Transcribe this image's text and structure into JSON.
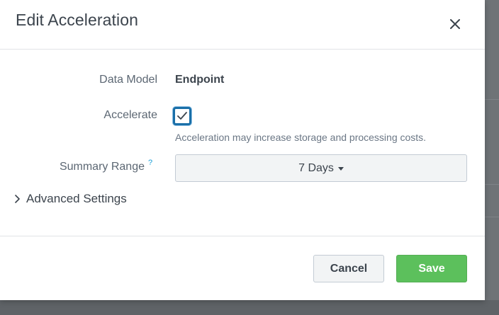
{
  "dialog": {
    "title": "Edit Acceleration"
  },
  "form": {
    "data_model": {
      "label": "Data Model",
      "value": "Endpoint"
    },
    "accelerate": {
      "label": "Accelerate",
      "checked": true,
      "help_text": "Acceleration may increase storage and processing costs."
    },
    "summary_range": {
      "label": "Summary Range",
      "help_mark": "?",
      "selected": "7 Days"
    },
    "advanced_settings": {
      "label": "Advanced Settings"
    }
  },
  "footer": {
    "cancel_label": "Cancel",
    "save_label": "Save"
  },
  "colors": {
    "save_button": "#5cc05c",
    "checkbox_border": "#1a6fa8",
    "help_link": "#1a9fd8"
  },
  "icons": {
    "close": "close-icon",
    "checkbox": "checkmark-icon",
    "advanced_toggle": "chevron-right-icon",
    "dropdown": "caret-down-icon"
  }
}
